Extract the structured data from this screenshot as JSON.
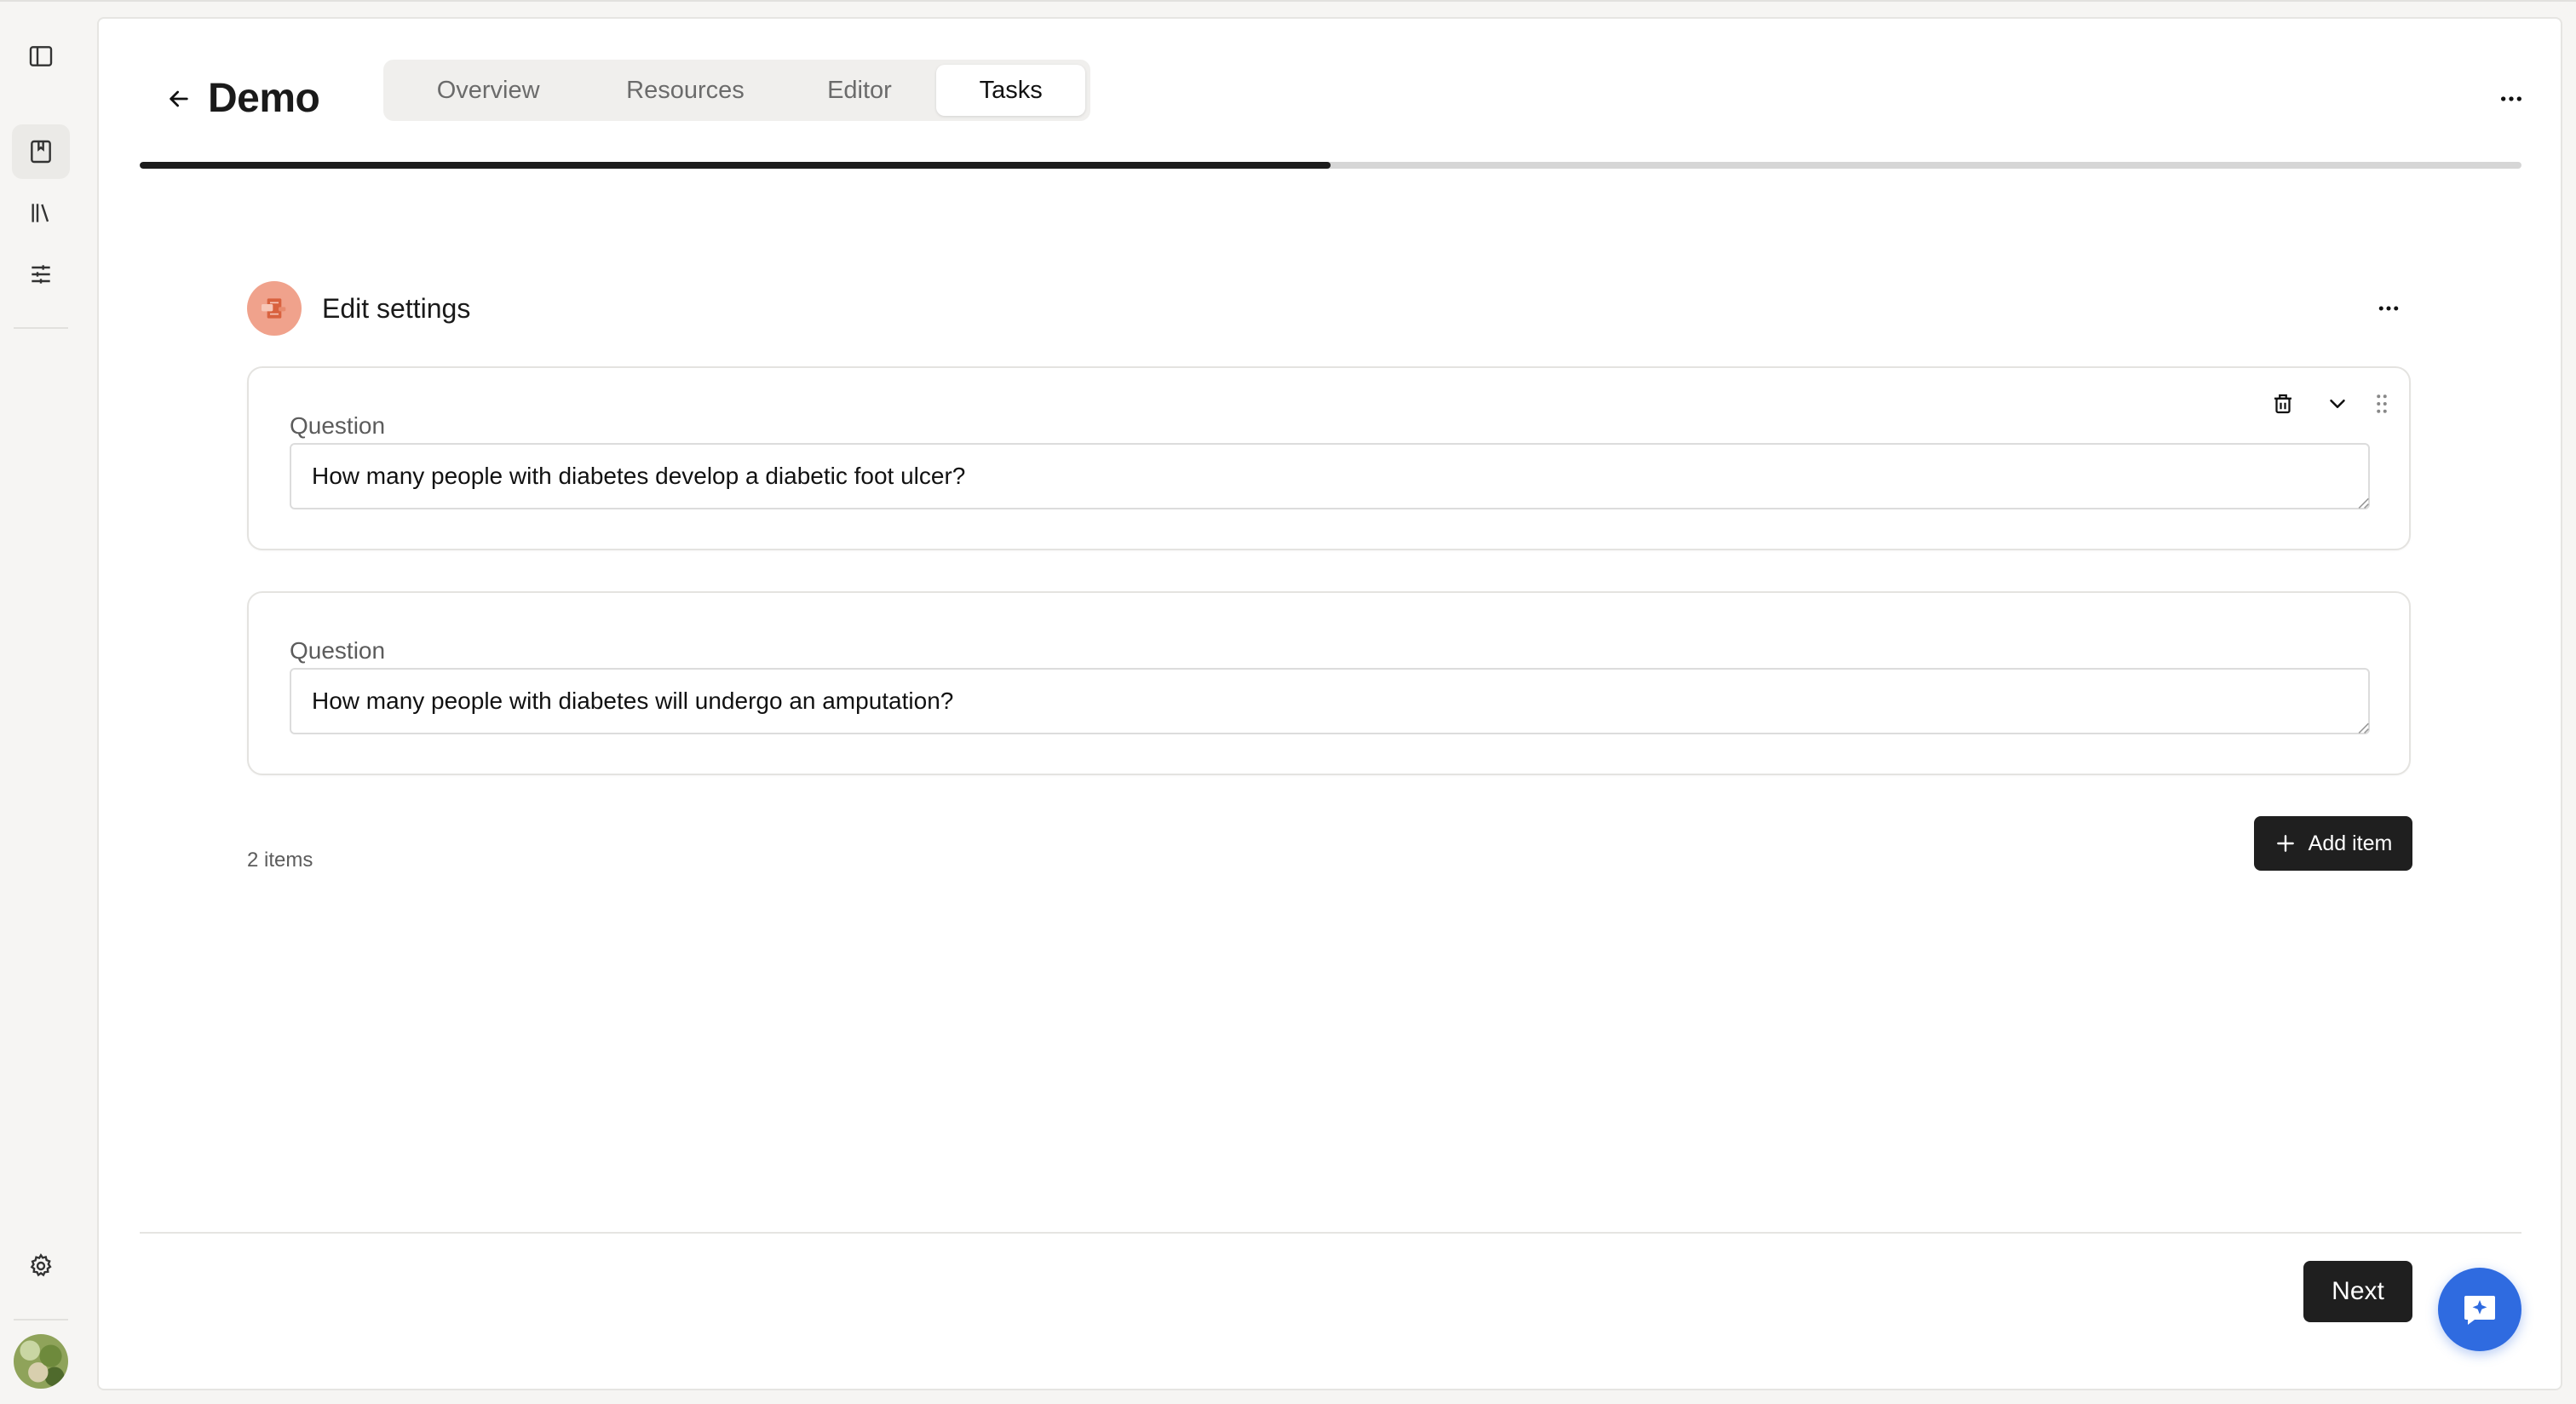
{
  "page": {
    "title": "Demo",
    "progress_fraction": 0.5
  },
  "tabs": [
    {
      "label": "Overview"
    },
    {
      "label": "Resources"
    },
    {
      "label": "Editor"
    },
    {
      "label": "Tasks"
    }
  ],
  "active_tab": "Tasks",
  "section": {
    "title": "Edit settings",
    "icon": "settings-illustration-icon"
  },
  "items": [
    {
      "label": "Question",
      "value": "How many people with diabetes develop a diabetic foot ulcer?"
    },
    {
      "label": "Question",
      "value": "How many people with diabetes will undergo an amputation?"
    }
  ],
  "footer": {
    "items_count": "2 items",
    "add_label": "Add item",
    "next_label": "Next"
  },
  "colors": {
    "accent": "#2f6be0",
    "primary_button": "#1f1f1f",
    "section_icon_bg": "#f0a28c"
  },
  "icons": {
    "rail": [
      "sidebar-toggle-icon",
      "bookmark-icon",
      "library-icon",
      "sliders-icon",
      "gear-icon"
    ],
    "chat": "chat-sparkle-icon"
  }
}
